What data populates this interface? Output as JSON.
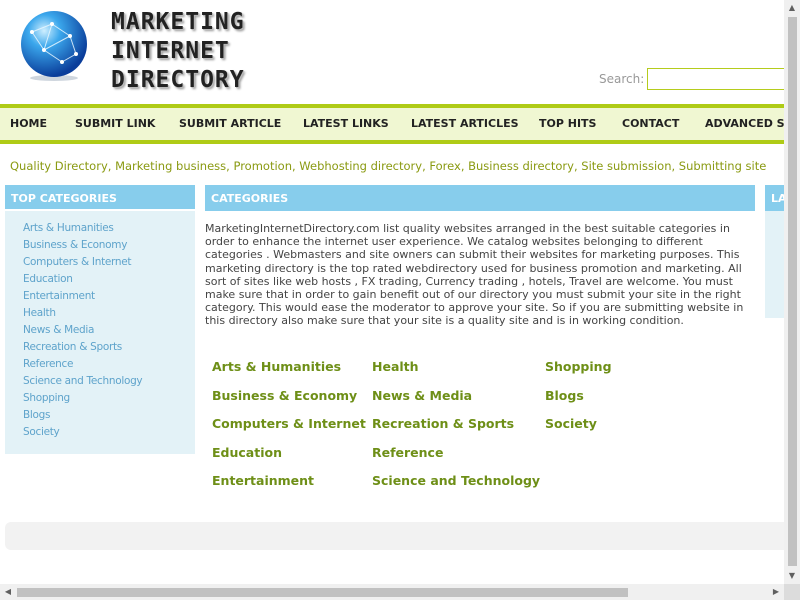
{
  "header": {
    "logo_lines": [
      "MARKETING",
      "INTERNET",
      "DIRECTORY"
    ],
    "search_label": "Search:",
    "search_value": "",
    "logo_icon": "globe-network-icon"
  },
  "nav": {
    "items": [
      {
        "label": "HOME"
      },
      {
        "label": "SUBMIT LINK"
      },
      {
        "label": "SUBMIT ARTICLE"
      },
      {
        "label": "LATEST LINKS"
      },
      {
        "label": "LATEST ARTICLES"
      },
      {
        "label": "TOP HITS"
      },
      {
        "label": "CONTACT"
      },
      {
        "label": "ADVANCED SE"
      }
    ]
  },
  "tagline": {
    "items": [
      "Quality Directory",
      "Marketing business",
      "Promotion",
      "Webhosting directory",
      "Forex",
      "Business directory",
      "Site submission",
      "Submitting site"
    ],
    "separator": ", "
  },
  "left_panel": {
    "title": "TOP CATEGORIES",
    "items": [
      "Arts & Humanities",
      "Business & Economy",
      "Computers & Internet",
      "Education",
      "Entertainment",
      "Health",
      "News & Media",
      "Recreation & Sports",
      "Reference",
      "Science and Technology",
      "Shopping",
      "Blogs",
      "Society"
    ]
  },
  "main_panel": {
    "title": "CATEGORIES",
    "description": "MarketingInternetDirectory.com list quality websites arranged in the best suitable categories in order to enhance the internet user experience. We catalog websites belonging to different categories . Webmasters and site owners can submit their websites for marketing purposes. This marketing directory is the top rated webdirectory used for business promotion and marketing. All sort of sites like web hosts , FX trading, Currency trading , hotels, Travel are welcome. You must make sure that in order to gain benefit out of our directory you must submit your site in the right category. This would ease the moderator to approve your site. So if you are submitting website in this directory also make sure that your site is a quality site and is in working condition.",
    "category_columns": [
      [
        "Arts & Humanities",
        "Business & Economy",
        "Computers & Internet",
        "Education",
        "Entertainment"
      ],
      [
        "Health",
        "News & Media",
        "Recreation & Sports",
        "Reference",
        "Science and Technology"
      ],
      [
        "Shopping",
        "Blogs",
        "Society"
      ]
    ]
  },
  "right_panel": {
    "title": "LA"
  },
  "colors": {
    "accent_green": "#afcb16",
    "nav_bg": "#f0f7d2",
    "panel_header": "#87cdec",
    "panel_bg": "#e3f2f7",
    "category_link": "#6e8f17",
    "tagline": "#8a9a12"
  }
}
